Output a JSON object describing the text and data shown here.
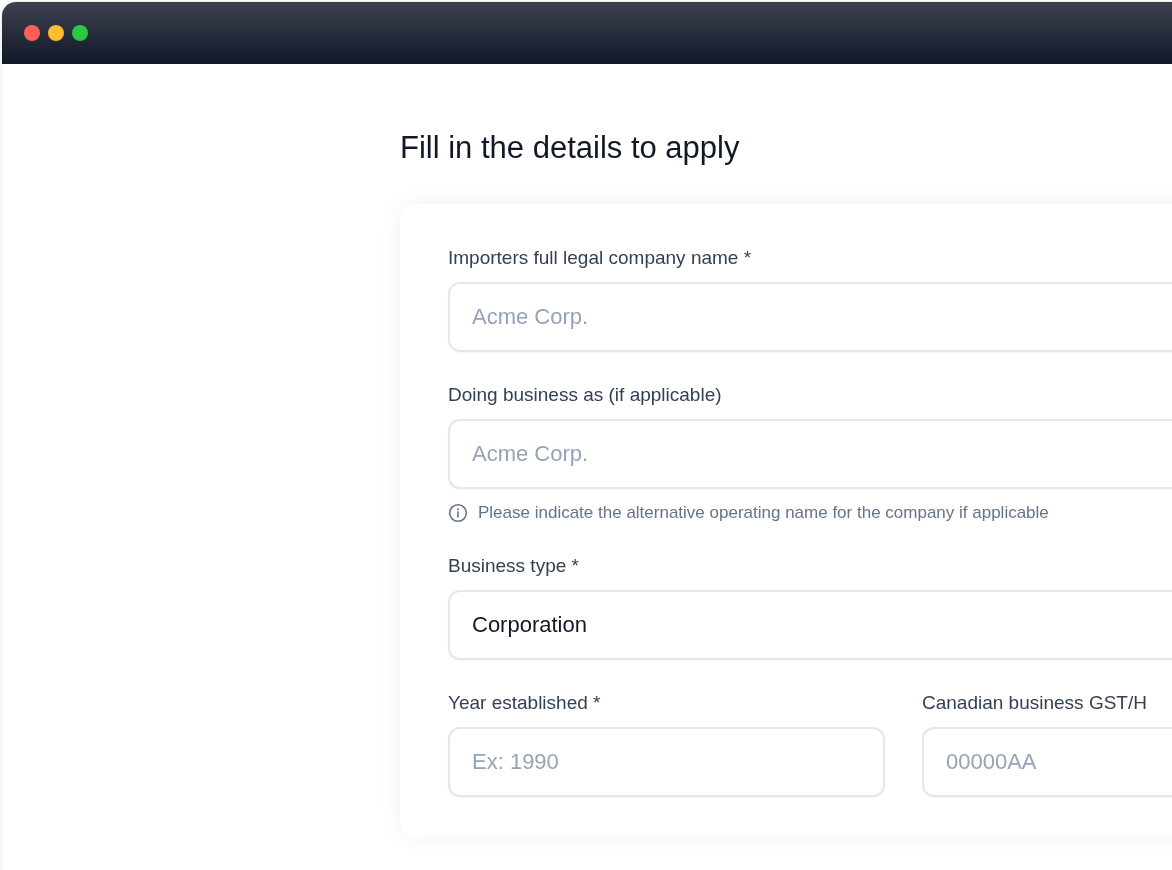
{
  "window": {
    "controls": [
      {
        "color": "#ff5f57"
      },
      {
        "color": "#febc2e"
      },
      {
        "color": "#28c840"
      }
    ]
  },
  "heading": "Fill in the details to apply",
  "fields": [
    {
      "kind": "text",
      "label": "Importers full legal company name *",
      "placeholder": "Acme Corp."
    },
    {
      "kind": "text",
      "label": "Doing business as (if applicable)",
      "placeholder": "Acme Corp.",
      "hint": "Please indicate the alternative operating name for the company if applicable"
    },
    {
      "kind": "select",
      "label": "Business type *",
      "value": "Corporation"
    }
  ],
  "field_row": [
    {
      "kind": "text",
      "label": "Year established *",
      "placeholder": "Ex: 1990"
    },
    {
      "kind": "text",
      "label": "Canadian business GST/H",
      "placeholder": "00000AA"
    }
  ]
}
